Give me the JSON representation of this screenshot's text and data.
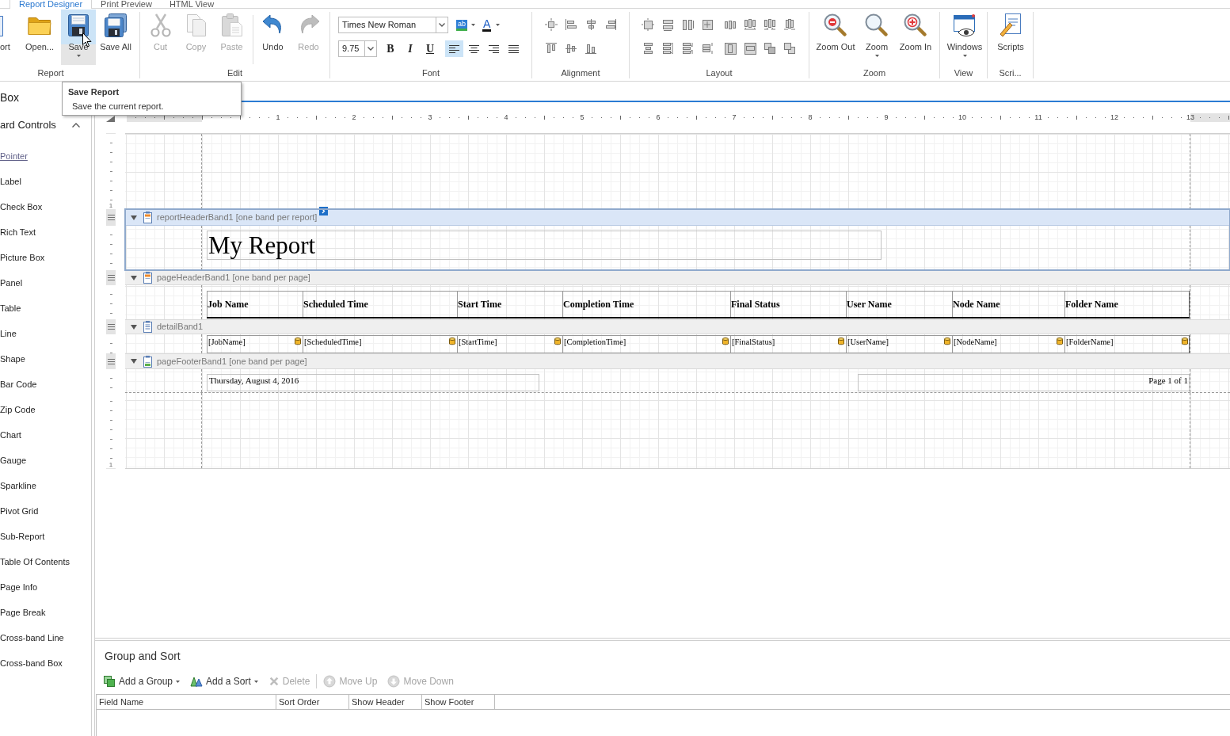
{
  "tabs": [
    {
      "label": "Report Designer",
      "selected": true
    },
    {
      "label": "Print Preview",
      "selected": false
    },
    {
      "label": "HTML View",
      "selected": false
    }
  ],
  "ribbon": {
    "groups": [
      {
        "kind": "buttons",
        "label": "Report",
        "buttons": [
          {
            "label": "ort",
            "disabled": false,
            "hovered": false,
            "dropdown": false
          },
          {
            "label": "Open...",
            "disabled": false,
            "hovered": false,
            "dropdown": false
          },
          {
            "label": "Save",
            "disabled": false,
            "hovered": true,
            "dropdown": true
          },
          {
            "label": "Save All",
            "disabled": false,
            "hovered": false,
            "dropdown": false
          }
        ]
      },
      {
        "kind": "buttons",
        "label": "Edit",
        "buttons": [
          {
            "label": "Cut",
            "disabled": true,
            "hovered": false,
            "dropdown": false
          },
          {
            "label": "Copy",
            "disabled": true,
            "hovered": false,
            "dropdown": false
          },
          {
            "label": "Paste",
            "disabled": true,
            "hovered": false,
            "dropdown": false
          },
          {
            "label": "Undo",
            "disabled": false,
            "hovered": false,
            "dropdown": false
          },
          {
            "label": "Redo",
            "disabled": true,
            "hovered": false,
            "dropdown": false
          }
        ]
      },
      {
        "kind": "font",
        "label": "Font",
        "font_name": "Times New Roman",
        "font_size": "9.75",
        "highlight_glyph": "ab",
        "color_glyph": "A",
        "styles": [
          {
            "label": "B",
            "selected": false
          },
          {
            "label": "I",
            "selected": false
          },
          {
            "label": "U",
            "selected": false
          }
        ],
        "alignments": [
          {
            "selected": true
          },
          {
            "selected": false
          },
          {
            "selected": false
          },
          {
            "selected": false
          }
        ]
      },
      {
        "kind": "icon_grid",
        "label": "Alignment"
      },
      {
        "kind": "icon_grid",
        "label": "Layout"
      },
      {
        "kind": "buttons",
        "label": "Zoom",
        "buttons": [
          {
            "label": "Zoom Out",
            "disabled": false,
            "hovered": false,
            "dropdown": false
          },
          {
            "label": "Zoom",
            "disabled": false,
            "hovered": false,
            "dropdown": true
          },
          {
            "label": "Zoom In",
            "disabled": false,
            "hovered": false,
            "dropdown": false
          }
        ]
      },
      {
        "kind": "buttons",
        "label": "View",
        "buttons": [
          {
            "label": "Windows",
            "disabled": false,
            "hovered": false,
            "dropdown": true
          }
        ]
      },
      {
        "kind": "buttons",
        "label": "Scri...",
        "buttons": [
          {
            "label": "Scripts",
            "disabled": false,
            "hovered": false,
            "dropdown": false
          }
        ]
      }
    ]
  },
  "tooltip": {
    "title": "Save Report",
    "text": "Save the current report."
  },
  "sidebar": {
    "title": "Box",
    "section": {
      "label": "ard Controls",
      "expanded": true,
      "items": [
        {
          "label": "Pointer",
          "selected": true
        },
        {
          "label": "Label",
          "selected": false
        },
        {
          "label": "Check Box",
          "selected": false
        },
        {
          "label": "Rich Text",
          "selected": false
        },
        {
          "label": "Picture Box",
          "selected": false
        },
        {
          "label": "Panel",
          "selected": false
        },
        {
          "label": "Table",
          "selected": false
        },
        {
          "label": "Line",
          "selected": false
        },
        {
          "label": "Shape",
          "selected": false
        },
        {
          "label": "Bar Code",
          "selected": false
        },
        {
          "label": "Zip Code",
          "selected": false
        },
        {
          "label": "Chart",
          "selected": false
        },
        {
          "label": "Gauge",
          "selected": false
        },
        {
          "label": "Sparkline",
          "selected": false
        },
        {
          "label": "Pivot Grid",
          "selected": false
        },
        {
          "label": "Sub-Report",
          "selected": false
        },
        {
          "label": "Table Of Contents",
          "selected": false
        },
        {
          "label": "Page Info",
          "selected": false
        },
        {
          "label": "Page Break",
          "selected": false
        },
        {
          "label": "Cross-band Line",
          "selected": false
        },
        {
          "label": "Cross-band Box",
          "selected": false
        }
      ]
    }
  },
  "designer": {
    "ruler_labels": [
      "1",
      "2",
      "3",
      "4",
      "5",
      "6",
      "7",
      "8",
      "9",
      "10",
      "11",
      "12",
      "13"
    ],
    "bands": [
      {
        "kind": "top_margin",
        "ruler_label": "1"
      },
      {
        "kind": "report_header",
        "title": "reportHeaderBand1 [one band per report]",
        "selected": true,
        "text": "My Report"
      },
      {
        "kind": "page_header",
        "title": "pageHeaderBand1 [one band per page]",
        "selected": false,
        "cells": [
          "Job Name",
          "Scheduled Time",
          "Start Time",
          "Completion Time",
          "Final Status",
          "User Name",
          "Node Name",
          "Folder Name"
        ]
      },
      {
        "kind": "detail",
        "title": "detailBand1",
        "selected": false,
        "cells": [
          "[JobName]",
          "[ScheduledTime]",
          "[StartTime]",
          "[CompletionTime]",
          "[FinalStatus]",
          "[UserName]",
          "[NodeName]",
          "[FolderName]"
        ]
      },
      {
        "kind": "page_footer",
        "title": "pageFooterBand1 [one band per page]",
        "selected": false,
        "date": "Thursday, August 4, 2016",
        "page": "Page 1 of 1"
      },
      {
        "kind": "bottom_margin",
        "ruler_label": "1"
      }
    ]
  },
  "group_sort": {
    "title": "Group and Sort",
    "toolbar": [
      {
        "label": "Add a Group",
        "dropdown": true,
        "disabled": false,
        "separator_before": false
      },
      {
        "label": "Add a Sort",
        "dropdown": true,
        "disabled": false,
        "separator_before": false
      },
      {
        "label": "Delete",
        "dropdown": false,
        "disabled": true,
        "separator_before": false
      },
      {
        "label": "Move Up",
        "dropdown": false,
        "disabled": true,
        "separator_before": true
      },
      {
        "label": "Move Down",
        "dropdown": false,
        "disabled": true,
        "separator_before": false
      }
    ],
    "columns": [
      "Field Name",
      "Sort Order",
      "Show Header",
      "Show Footer"
    ]
  }
}
